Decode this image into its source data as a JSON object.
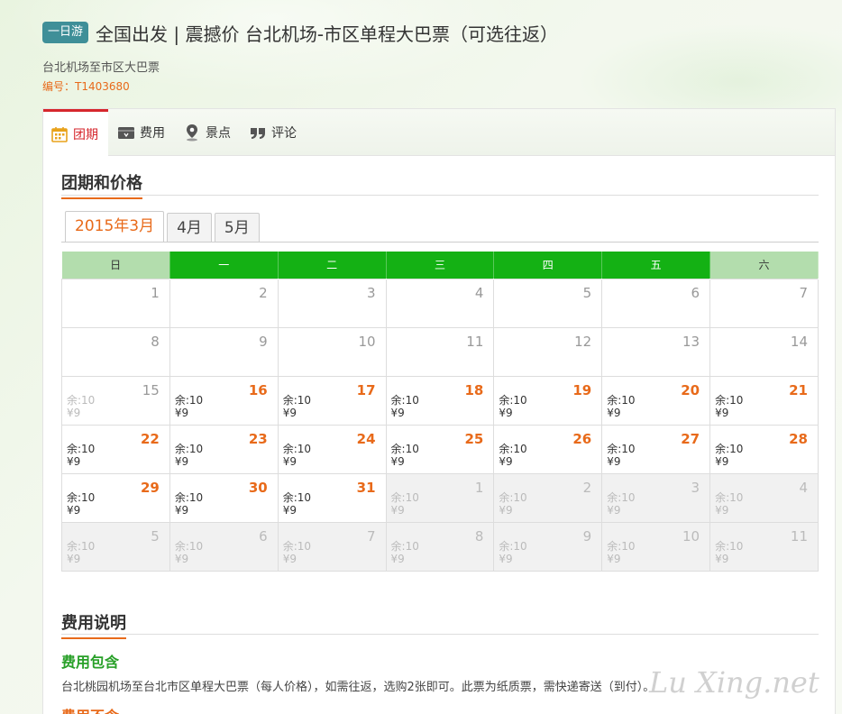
{
  "header": {
    "badge": "一日游",
    "title": "全国出发 | 震撼价 台北机场-市区单程大巴票（可选往返）",
    "subtitle": "台北机场至市区大巴票",
    "code": "编号：T1403680"
  },
  "tabs": [
    {
      "label": "团期",
      "icon": "calendar-icon"
    },
    {
      "label": "费用",
      "icon": "wallet-icon"
    },
    {
      "label": "景点",
      "icon": "map-pin-icon"
    },
    {
      "label": "评论",
      "icon": "quote-icon"
    }
  ],
  "section_dates_title": "团期和价格",
  "months": [
    "2015年3月",
    "4月",
    "5月"
  ],
  "weekdays": [
    "日",
    "一",
    "二",
    "三",
    "四",
    "五",
    "六"
  ],
  "calendar": {
    "remain_label": "余:10",
    "price_label": "¥9",
    "weeks": [
      [
        {
          "d": "1",
          "s": "empty"
        },
        {
          "d": "2",
          "s": "empty"
        },
        {
          "d": "3",
          "s": "empty"
        },
        {
          "d": "4",
          "s": "empty"
        },
        {
          "d": "5",
          "s": "empty"
        },
        {
          "d": "6",
          "s": "empty"
        },
        {
          "d": "7",
          "s": "empty"
        }
      ],
      [
        {
          "d": "8",
          "s": "empty"
        },
        {
          "d": "9",
          "s": "empty"
        },
        {
          "d": "10",
          "s": "empty"
        },
        {
          "d": "11",
          "s": "empty"
        },
        {
          "d": "12",
          "s": "empty"
        },
        {
          "d": "13",
          "s": "empty"
        },
        {
          "d": "14",
          "s": "empty"
        }
      ],
      [
        {
          "d": "15",
          "s": "faded"
        },
        {
          "d": "16",
          "s": "avail"
        },
        {
          "d": "17",
          "s": "avail"
        },
        {
          "d": "18",
          "s": "avail"
        },
        {
          "d": "19",
          "s": "avail"
        },
        {
          "d": "20",
          "s": "avail"
        },
        {
          "d": "21",
          "s": "avail"
        }
      ],
      [
        {
          "d": "22",
          "s": "avail"
        },
        {
          "d": "23",
          "s": "avail"
        },
        {
          "d": "24",
          "s": "avail"
        },
        {
          "d": "25",
          "s": "avail"
        },
        {
          "d": "26",
          "s": "avail"
        },
        {
          "d": "27",
          "s": "avail"
        },
        {
          "d": "28",
          "s": "avail"
        }
      ],
      [
        {
          "d": "29",
          "s": "avail"
        },
        {
          "d": "30",
          "s": "avail"
        },
        {
          "d": "31",
          "s": "avail"
        },
        {
          "d": "1",
          "s": "other"
        },
        {
          "d": "2",
          "s": "other"
        },
        {
          "d": "3",
          "s": "other"
        },
        {
          "d": "4",
          "s": "other"
        }
      ],
      [
        {
          "d": "5",
          "s": "other"
        },
        {
          "d": "6",
          "s": "other"
        },
        {
          "d": "7",
          "s": "other"
        },
        {
          "d": "8",
          "s": "other"
        },
        {
          "d": "9",
          "s": "other"
        },
        {
          "d": "10",
          "s": "other"
        },
        {
          "d": "11",
          "s": "other"
        }
      ]
    ]
  },
  "fees": {
    "title": "费用说明",
    "include_title": "费用包含",
    "include_text": "台北桃园机场至台北市区单程大巴票（每人价格），如需往返，选购2张即可。此票为纸质票，需快递寄送（到付）。",
    "exclude_title": "费用不含"
  },
  "watermark": "Lu Xing.net",
  "colors": {
    "accent_orange": "#e86a1a",
    "active_tab_red": "#d6262c",
    "weekday_green": "#14b114",
    "weekend_green": "#b3ddad",
    "badge_teal": "#3f8f98",
    "include_green": "#28a028"
  }
}
